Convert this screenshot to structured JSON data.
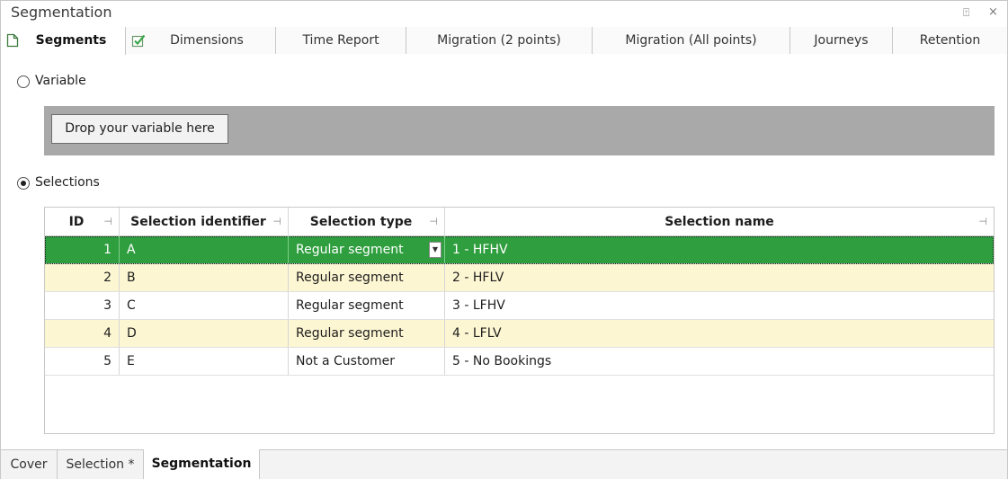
{
  "window": {
    "title": "Segmentation",
    "pin_glyph": "⍐",
    "close_glyph": "×"
  },
  "tabs": [
    {
      "label": "Segments",
      "icon": "document-icon",
      "active": true
    },
    {
      "label": "Dimensions",
      "icon": "checked-box-icon",
      "active": false
    },
    {
      "label": "Time Report",
      "active": false
    },
    {
      "label": "Migration (2 points)",
      "active": false
    },
    {
      "label": "Migration (All points)",
      "active": false
    },
    {
      "label": "Journeys",
      "active": false
    },
    {
      "label": "Retention",
      "active": false
    }
  ],
  "mode": {
    "variable_label": "Variable",
    "drop_button": "Drop your variable here",
    "selections_label": "Selections",
    "selected": "Selections"
  },
  "grid": {
    "columns": [
      "ID",
      "Selection identifier",
      "Selection type",
      "Selection name"
    ],
    "rows": [
      {
        "id": "1",
        "identifier": "A",
        "type": "Regular segment",
        "name": "1 - HFHV"
      },
      {
        "id": "2",
        "identifier": "B",
        "type": "Regular segment",
        "name": "2 - HFLV"
      },
      {
        "id": "3",
        "identifier": "C",
        "type": "Regular segment",
        "name": "3 - LFHV"
      },
      {
        "id": "4",
        "identifier": "D",
        "type": "Regular segment",
        "name": "4 - LFLV"
      },
      {
        "id": "5",
        "identifier": "E",
        "type": "Not a Customer",
        "name": "5 - No Bookings"
      }
    ],
    "selected_row": 1
  },
  "bottom_tabs": [
    {
      "label": "Cover",
      "active": false
    },
    {
      "label": "Selection *",
      "active": false
    },
    {
      "label": "Segmentation",
      "active": true
    }
  ],
  "colors": {
    "selected_row": "#2e9e3e",
    "alt_row": "#fdf6d2",
    "drop_zone": "#a9a9a9"
  }
}
